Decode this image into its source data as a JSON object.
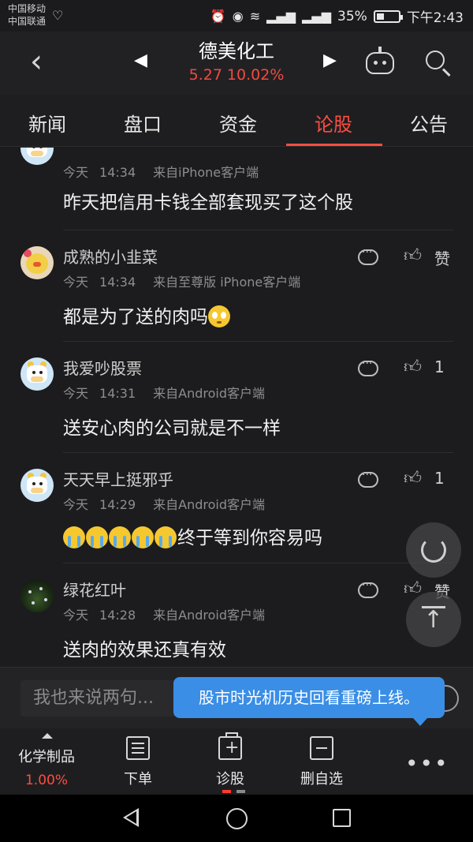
{
  "status_bar": {
    "carrier_1": "中国移动",
    "carrier_2": "中国联通",
    "battery": "35%",
    "battery_level": 0.35,
    "time": "下午2:43",
    "icons": [
      "heart-rate-icon",
      "alarm-icon",
      "eye-icon",
      "wifi-icon",
      "signal-4g-icon",
      "signal-2g-icon",
      "battery-icon"
    ]
  },
  "header": {
    "stock_name": "德美化工",
    "price": "5.27",
    "change": "10.02%",
    "price_color": "#f24a3f"
  },
  "tabs": [
    {
      "label": "新闻"
    },
    {
      "label": "盘口"
    },
    {
      "label": "资金"
    },
    {
      "label": "论股",
      "active": true
    },
    {
      "label": "公告"
    }
  ],
  "posts": [
    {
      "user": "",
      "day": "今天",
      "time": "14:34",
      "source": "来自iPhone客户端",
      "content": "昨天把信用卡钱全部套现买了这个股",
      "likes": "",
      "avatar": "cow-avatar"
    },
    {
      "user": "成熟的小韭菜",
      "day": "今天",
      "time": "14:34",
      "source": "来自至尊版 iPhone客户端",
      "content": "都是为了送的肉吗",
      "likes": "赞",
      "avatar": "chick-avatar"
    },
    {
      "user": "我爱吵股票",
      "day": "今天",
      "time": "14:31",
      "source": "来自Android客户端",
      "content": "送安心肉的公司就是不一样",
      "likes": "1",
      "avatar": "cow-avatar"
    },
    {
      "user": "天天早上挺邪乎",
      "day": "今天",
      "time": "14:29",
      "source": "来自Android客户端",
      "content": "终于等到你容易吗",
      "likes": "1",
      "avatar": "cow-avatar"
    },
    {
      "user": "绿花红叶",
      "day": "今天",
      "time": "14:28",
      "source": "来自Android客户端",
      "content": "送肉的效果还真有效",
      "likes": "赞",
      "avatar": "plant-avatar"
    }
  ],
  "input": {
    "placeholder": "我也来说两句..."
  },
  "tooltip": {
    "text": "股市时光机历史回看重磅上线。"
  },
  "toolbar": {
    "industry_name": "化学制品",
    "industry_change": "1.00%",
    "order_label": "下单",
    "diagnose_label": "诊股",
    "remove_label": "删自选",
    "more_label": "•••"
  }
}
